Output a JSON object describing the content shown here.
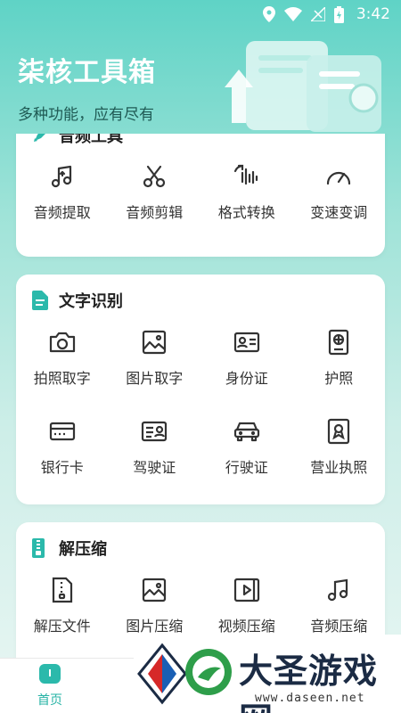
{
  "status": {
    "time": "3:42"
  },
  "header": {
    "title": "柒核工具箱",
    "subtitle": "多种功能，应有尽有"
  },
  "sections": [
    {
      "title": "音频工具",
      "items": [
        {
          "label": "音频提取",
          "icon": "music-note-icon"
        },
        {
          "label": "音频剪辑",
          "icon": "scissors-icon"
        },
        {
          "label": "格式转换",
          "icon": "waveform-convert-icon"
        },
        {
          "label": "变速变调",
          "icon": "speedometer-icon"
        }
      ]
    },
    {
      "title": "文字识别",
      "items": [
        {
          "label": "拍照取字",
          "icon": "camera-icon"
        },
        {
          "label": "图片取字",
          "icon": "image-icon"
        },
        {
          "label": "身份证",
          "icon": "id-card-icon"
        },
        {
          "label": "护照",
          "icon": "passport-icon"
        },
        {
          "label": "银行卡",
          "icon": "bank-card-icon"
        },
        {
          "label": "驾驶证",
          "icon": "driver-license-icon"
        },
        {
          "label": "行驶证",
          "icon": "car-icon"
        },
        {
          "label": "营业执照",
          "icon": "business-license-icon"
        }
      ]
    },
    {
      "title": "解压缩",
      "items": [
        {
          "label": "解压文件",
          "icon": "zip-file-icon"
        },
        {
          "label": "图片压缩",
          "icon": "image-compress-icon"
        },
        {
          "label": "视频压缩",
          "icon": "video-compress-icon"
        },
        {
          "label": "音频压缩",
          "icon": "music-compress-icon"
        }
      ]
    }
  ],
  "nav": {
    "home_label": "首页"
  },
  "watermark": {
    "text": "大圣游戏网",
    "url": "www.daseen.net"
  },
  "colors": {
    "accent": "#26b3a5",
    "icon": "#333333",
    "brand_teal": "#5fd3c6"
  }
}
